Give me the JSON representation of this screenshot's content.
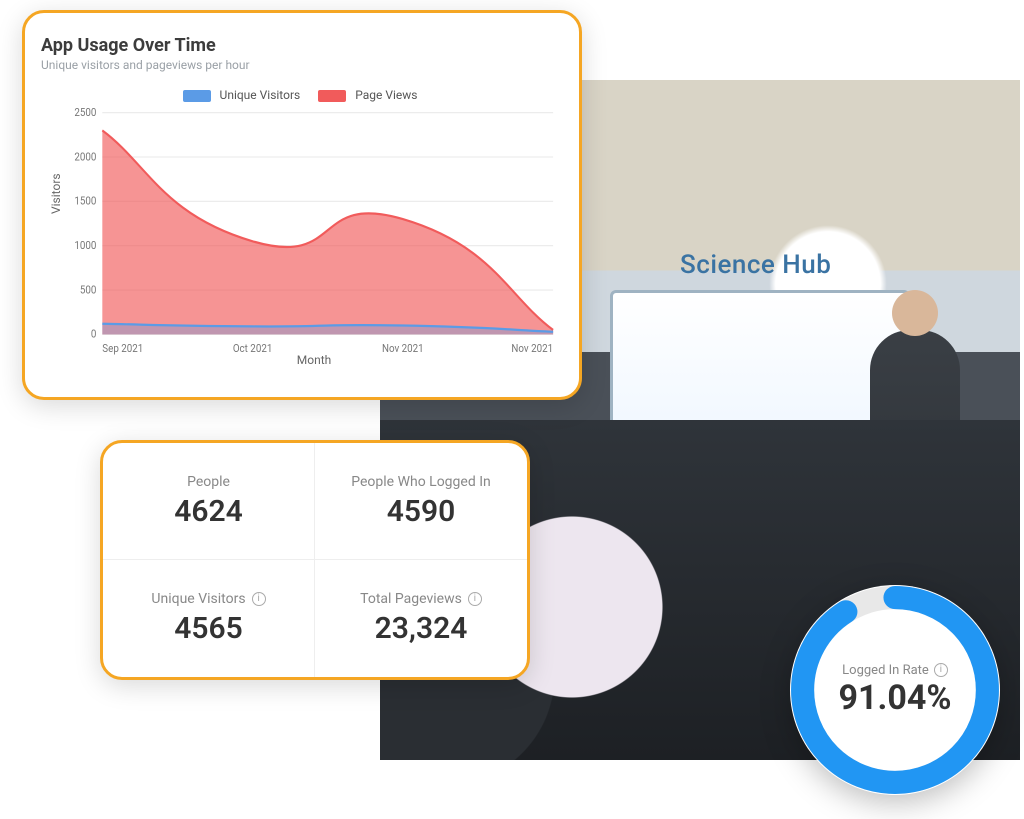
{
  "photo": {
    "sign_text": "Science Hub"
  },
  "chart_card": {
    "title": "App Usage Over Time",
    "subtitle": "Unique visitors and pageviews per hour",
    "legend": {
      "uv": "Unique Visitors",
      "pv": "Page Views"
    },
    "yaxis_label": "Visitors",
    "xaxis_label": "Month"
  },
  "chart_data": {
    "type": "area",
    "title": "App Usage Over Time",
    "xlabel": "Month",
    "ylabel": "Visitors",
    "ylim": [
      0,
      2500
    ],
    "yticks": [
      0,
      500,
      1000,
      1500,
      2000,
      2500
    ],
    "categories": [
      "Sep 2021",
      "Oct 2021",
      "Nov 2021",
      "Nov 2021"
    ],
    "series": [
      {
        "name": "Page Views",
        "color": "#f15b5b",
        "values": [
          2300,
          1050,
          1300,
          50
        ]
      },
      {
        "name": "Unique Visitors",
        "color": "#5b9be6",
        "values": [
          120,
          90,
          100,
          30
        ]
      }
    ]
  },
  "stats": {
    "people": {
      "label": "People",
      "value": "4624"
    },
    "logged_in": {
      "label": "People Who Logged In",
      "value": "4590"
    },
    "unique_visitors": {
      "label": "Unique Visitors",
      "value": "4565",
      "has_info": true
    },
    "total_pageviews": {
      "label": "Total Pageviews",
      "value": "23,324",
      "has_info": true
    }
  },
  "gauge": {
    "label": "Logged In Rate",
    "value": "91.04%",
    "fraction": 0.9104
  }
}
